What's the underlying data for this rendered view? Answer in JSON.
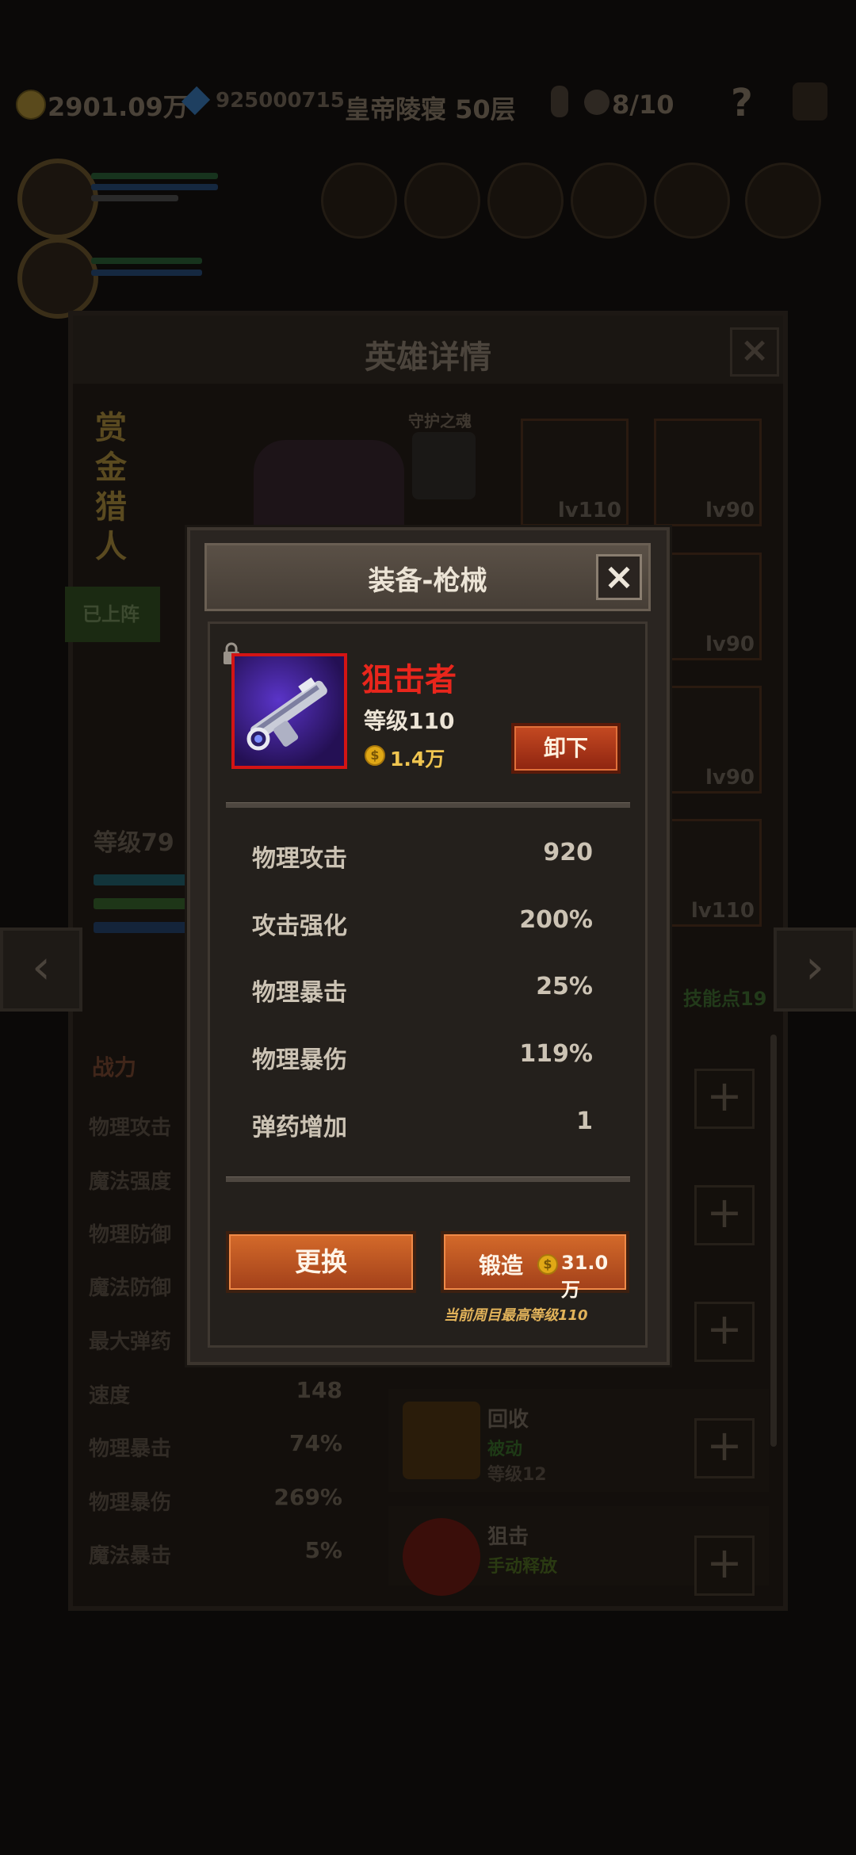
{
  "background": {
    "gold": "2901.09万",
    "gems": "925000715",
    "stage": "皇帝陵寝 50层",
    "keys": "8/10",
    "help": "?",
    "hero_panel_title": "英雄详情",
    "hero_name": "赏金猎人",
    "deployed_label": "已上阵",
    "guardian_label": "守护之魂",
    "hero_level": "等级79",
    "skill_points": "技能点19",
    "equip_levels": [
      "lv110",
      "lv90",
      "lv90",
      "lv90",
      "lv110"
    ],
    "power_tab": "战力",
    "stats": [
      {
        "label": "物理攻击",
        "value": ""
      },
      {
        "label": "魔法强度",
        "value": ""
      },
      {
        "label": "物理防御",
        "value": ""
      },
      {
        "label": "魔法防御",
        "value": ""
      },
      {
        "label": "最大弹药",
        "value": ""
      },
      {
        "label": "速度",
        "value": "148"
      },
      {
        "label": "物理暴击",
        "value": "74%"
      },
      {
        "label": "物理暴伤",
        "value": "269%"
      },
      {
        "label": "魔法暴击",
        "value": "5%"
      }
    ],
    "skills": [
      {
        "name": "回收",
        "type": "被动",
        "level": "等级12"
      },
      {
        "name": "狙击",
        "type": "手动释放",
        "level": ""
      }
    ]
  },
  "modal": {
    "title": "装备-枪械",
    "item_name": "狙击者",
    "item_level": "等级110",
    "item_price": "1.4万",
    "unequip_label": "卸下",
    "attributes": [
      {
        "label": "物理攻击",
        "value": "920"
      },
      {
        "label": "攻击强化",
        "value": "200%"
      },
      {
        "label": "物理暴击",
        "value": "25%"
      },
      {
        "label": "物理暴伤",
        "value": "119%"
      },
      {
        "label": "弹药增加",
        "value": "1"
      }
    ],
    "change_label": "更换",
    "forge_label": "锻造",
    "forge_cost": "31.0万",
    "max_level_note": "当前周目最高等级110"
  },
  "colors": {
    "item_name": "#e8261c",
    "button_orange": "#c25a24",
    "gold_text": "#f0c550"
  }
}
